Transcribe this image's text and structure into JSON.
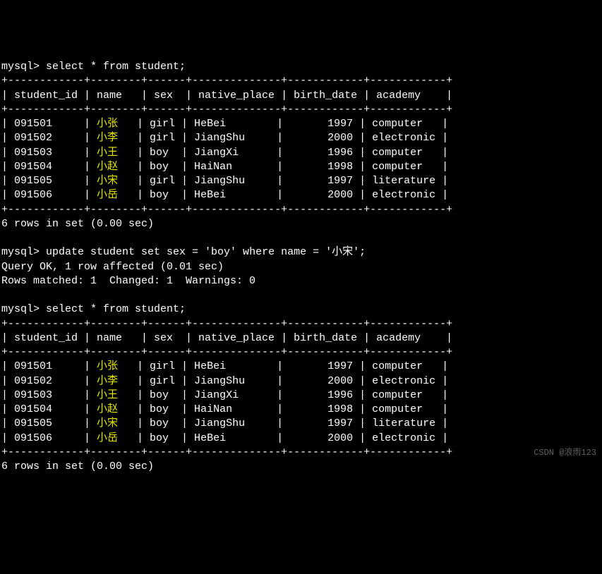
{
  "q1": {
    "prompt": "mysql> ",
    "query": "select * from student;",
    "headers": [
      "student_id",
      "name",
      "sex",
      "native_place",
      "birth_date",
      "academy"
    ],
    "rows": [
      {
        "id": "091501",
        "name": "小张",
        "sex": "girl",
        "np": "HeBei",
        "bd": "1997",
        "ac": "computer"
      },
      {
        "id": "091502",
        "name": "小李",
        "sex": "girl",
        "np": "JiangShu",
        "bd": "2000",
        "ac": "electronic"
      },
      {
        "id": "091503",
        "name": "小王",
        "sex": "boy",
        "np": "JiangXi",
        "bd": "1996",
        "ac": "computer"
      },
      {
        "id": "091504",
        "name": "小赵",
        "sex": "boy",
        "np": "HaiNan",
        "bd": "1998",
        "ac": "computer"
      },
      {
        "id": "091505",
        "name": "小宋",
        "sex": "girl",
        "np": "JiangShu",
        "bd": "1997",
        "ac": "literature"
      },
      {
        "id": "091506",
        "name": "小岳",
        "sex": "boy",
        "np": "HeBei",
        "bd": "2000",
        "ac": "electronic"
      }
    ],
    "footer": "6 rows in set (0.00 sec)"
  },
  "upd": {
    "prompt": "mysql> ",
    "query": "update student set sex = 'boy' where name = '小宋';",
    "r1": "Query OK, 1 row affected (0.01 sec)",
    "r2": "Rows matched: 1  Changed: 1  Warnings: 0"
  },
  "q2": {
    "prompt": "mysql> ",
    "query": "select * from student;",
    "headers": [
      "student_id",
      "name",
      "sex",
      "native_place",
      "birth_date",
      "academy"
    ],
    "rows": [
      {
        "id": "091501",
        "name": "小张",
        "sex": "girl",
        "np": "HeBei",
        "bd": "1997",
        "ac": "computer"
      },
      {
        "id": "091502",
        "name": "小李",
        "sex": "girl",
        "np": "JiangShu",
        "bd": "2000",
        "ac": "electronic"
      },
      {
        "id": "091503",
        "name": "小王",
        "sex": "boy",
        "np": "JiangXi",
        "bd": "1996",
        "ac": "computer"
      },
      {
        "id": "091504",
        "name": "小赵",
        "sex": "boy",
        "np": "HaiNan",
        "bd": "1998",
        "ac": "computer"
      },
      {
        "id": "091505",
        "name": "小宋",
        "sex": "boy",
        "np": "JiangShu",
        "bd": "1997",
        "ac": "literature"
      },
      {
        "id": "091506",
        "name": "小岳",
        "sex": "boy",
        "np": "HeBei",
        "bd": "2000",
        "ac": "electronic"
      }
    ],
    "footer": "6 rows in set (0.00 sec)"
  },
  "border": "+------------+--------+------+--------------+------------+------------+",
  "watermark": "CSDN @浪雨123"
}
